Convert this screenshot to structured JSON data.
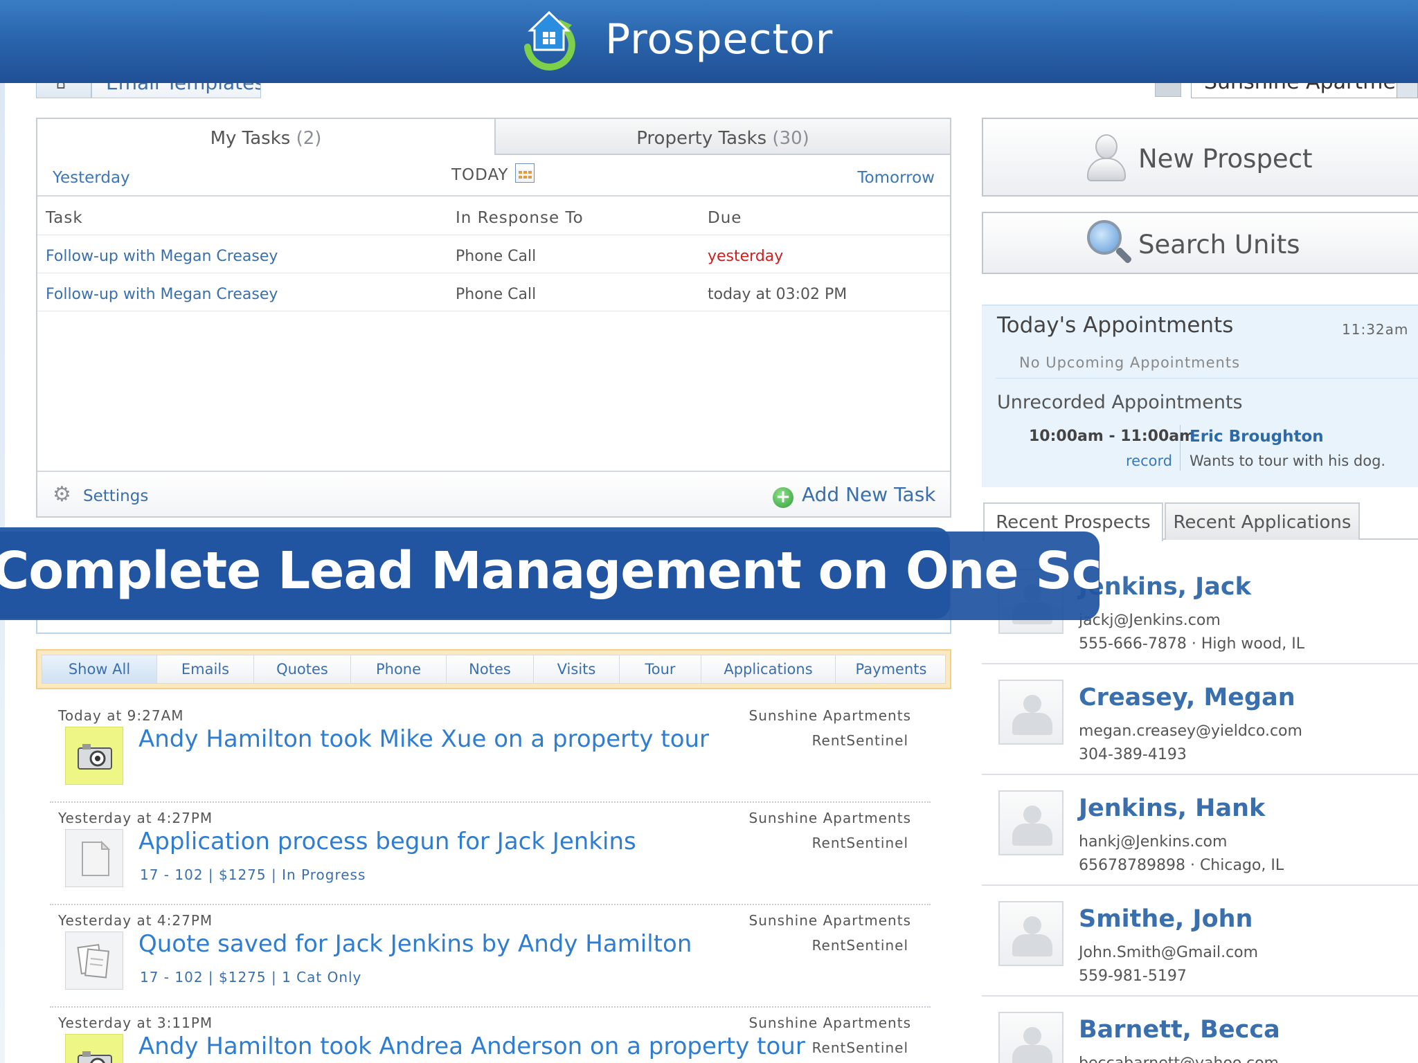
{
  "banner": {
    "title": "Prospector"
  },
  "toolbar": {
    "email_templates_label": "Email Templates",
    "property_selected": "Sunshine Apartments"
  },
  "tasks": {
    "tabs": [
      {
        "label": "My Tasks",
        "count": "(2)"
      },
      {
        "label": "Property Tasks",
        "count": "(30)"
      }
    ],
    "nav": {
      "prev": "Yesterday",
      "current": "TODAY",
      "next": "Tomorrow"
    },
    "columns": [
      "Task",
      "In Response To",
      "Due"
    ],
    "rows": [
      {
        "task": "Follow-up with Megan Creasey",
        "response": "Phone Call",
        "due": "yesterday"
      },
      {
        "task": "Follow-up with Megan Creasey",
        "response": "Phone Call",
        "due": "today at 03:02 PM"
      }
    ],
    "settings_label": "Settings",
    "add_task_label": "Add New Task"
  },
  "actions": {
    "new_prospect": "New Prospect",
    "search_units": "Search Units"
  },
  "appointments": {
    "title": "Today's Appointments",
    "time": "11:32am",
    "none_text": "No Upcoming Appointments",
    "unrecorded_title": "Unrecorded Appointments",
    "item": {
      "time": "10:00am - 11:00am",
      "record_label": "record",
      "name": "Eric Broughton",
      "note": "Wants to tour with his dog."
    }
  },
  "recent": {
    "tabs": [
      "Recent Prospects",
      "Recent Applications"
    ],
    "prospects": [
      {
        "name": "Jenkins, Jack",
        "email": "jackj@Jenkins.com",
        "phone": "555-666-7878 · High wood, IL"
      },
      {
        "name": "Creasey, Megan",
        "email": "megan.creasey@yieldco.com",
        "phone": "304-389-4193"
      },
      {
        "name": "Jenkins, Hank",
        "email": "hankj@Jenkins.com",
        "phone": "65678789898 · Chicago, IL"
      },
      {
        "name": "Smithe, John",
        "email": "John.Smith@Gmail.com",
        "phone": "559-981-5197"
      },
      {
        "name": "Barnett, Becca",
        "email": "beccabarnett@yahoo.com",
        "phone": ""
      }
    ]
  },
  "activity": {
    "filters": [
      "Show All",
      "Emails",
      "Quotes",
      "Phone",
      "Notes",
      "Visits",
      "Tour",
      "Applications",
      "Payments"
    ],
    "items": [
      {
        "time": "Today at 9:27AM",
        "property": "Sunshine Apartments",
        "source": "RentSentinel",
        "icon": "camera-icon",
        "title": "Andy Hamilton took Mike Xue on a property tour",
        "sub": ""
      },
      {
        "time": "Yesterday at 4:27PM",
        "property": "Sunshine Apartments",
        "source": "RentSentinel",
        "icon": "document-icon",
        "title": "Application process begun for Jack Jenkins",
        "sub": "17 - 102 | $1275 | In Progress"
      },
      {
        "time": "Yesterday at 4:27PM",
        "property": "Sunshine Apartments",
        "source": "RentSentinel",
        "icon": "papers-icon",
        "title": "Quote saved for Jack Jenkins by Andy Hamilton",
        "sub": "17 - 102 | $1275 | 1 Cat Only"
      },
      {
        "time": "Yesterday at 3:11PM",
        "property": "Sunshine Apartments",
        "source": "RentSentinel",
        "icon": "camera-icon",
        "title": "Andy Hamilton took Andrea Anderson on a property tour",
        "sub": ""
      }
    ]
  },
  "caption": {
    "text": "Complete Lead Management on One Screen"
  },
  "colors": {
    "banner": "#2a65ad",
    "caption": "#2054a0",
    "link": "#3a6fae",
    "overdue": "#cc1f1f",
    "filter_bar": "#fde9bf"
  }
}
